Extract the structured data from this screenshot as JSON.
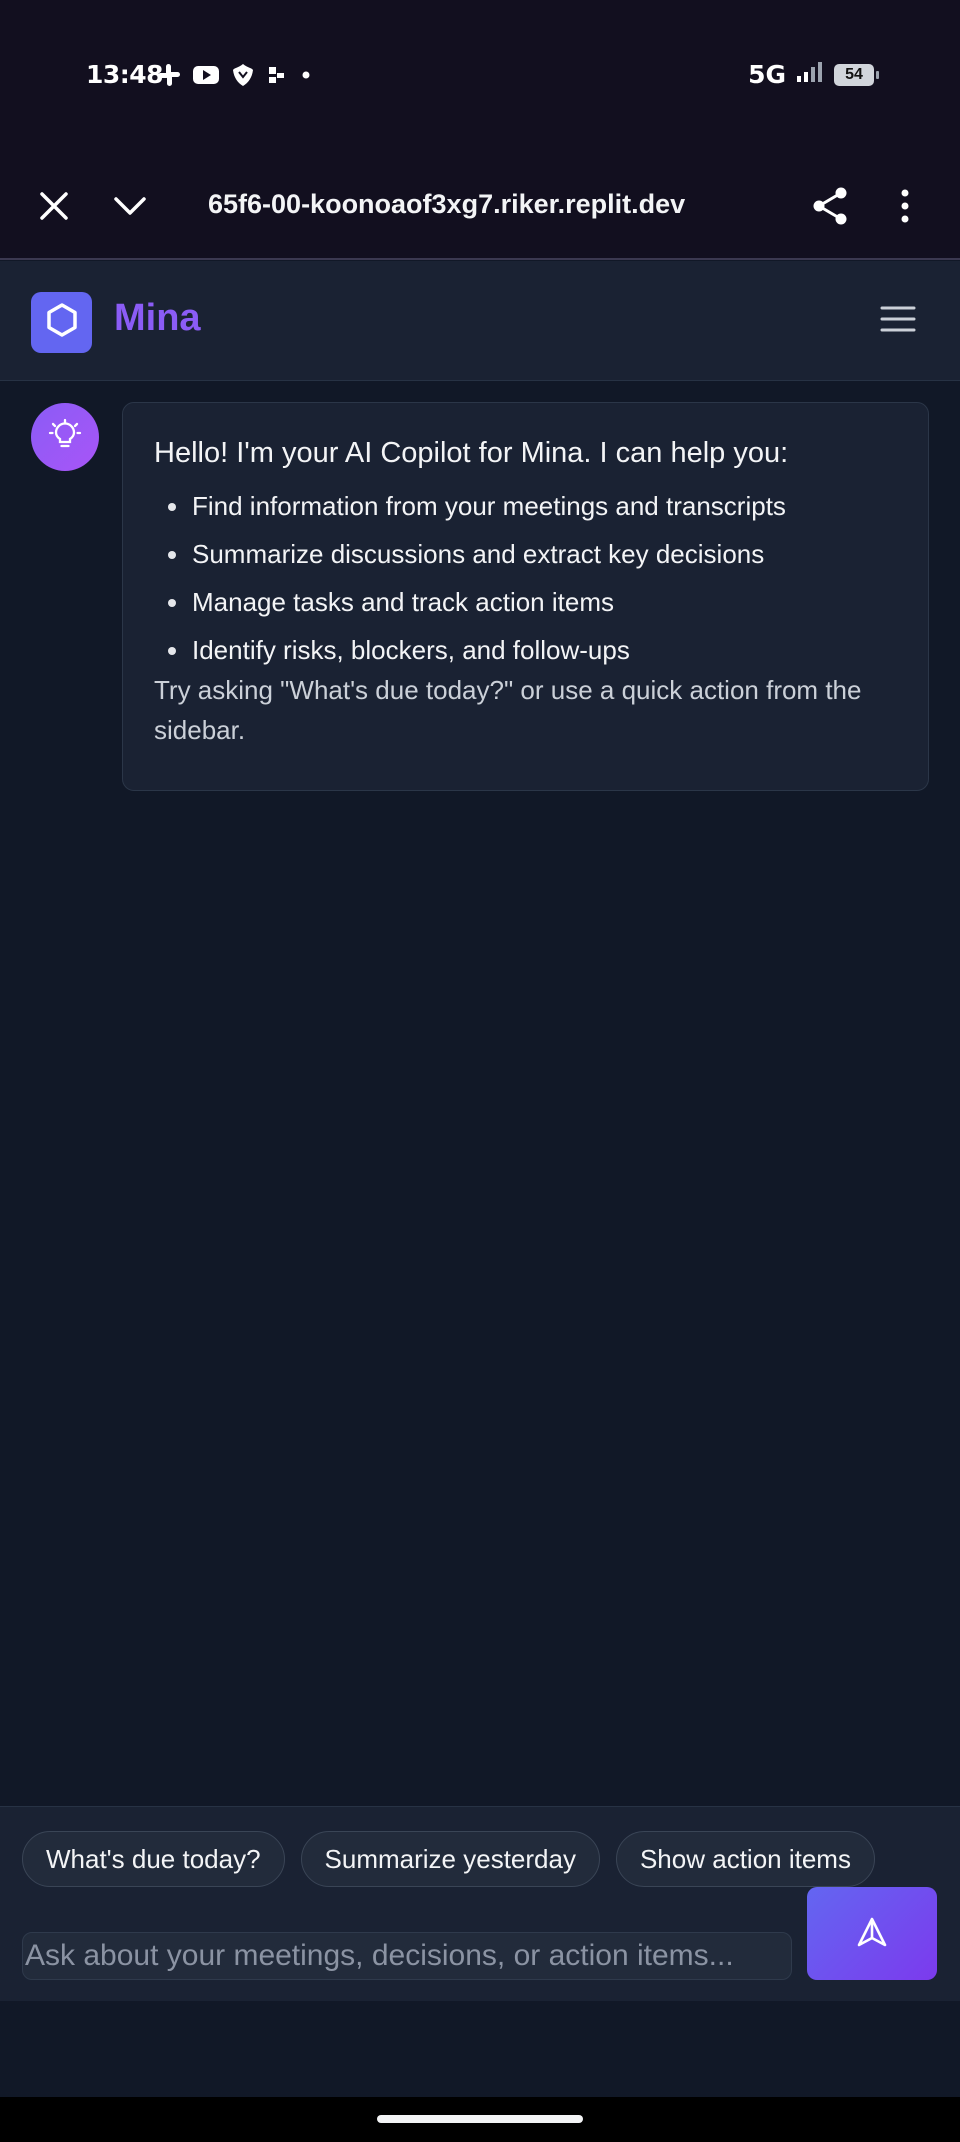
{
  "status_bar": {
    "time": "13:48",
    "notification_icons": [
      "slack-icon",
      "youtube-icon",
      "bank-icon",
      "puzzle-icon",
      "dot-icon"
    ],
    "network": "5G",
    "battery": "54"
  },
  "browser": {
    "url": "65f6-00-koonoaof3xg7.riker.replit.dev",
    "icons": [
      "close-icon",
      "chevron-down-icon",
      "share-icon",
      "more-vertical-icon"
    ]
  },
  "app": {
    "name": "Mina",
    "logo_icon": "hexagon-icon",
    "menu_icon": "hamburger-menu-icon",
    "accent_color": "#8b5cf6"
  },
  "chat": {
    "assistant_avatar_icon": "lightbulb-icon",
    "messages": [
      {
        "intro": "Hello! I'm your AI Copilot for Mina. I can help you:",
        "bullets": [
          "Find information from your meetings and transcripts",
          "Summarize discussions and extract key decisions",
          "Manage tasks and track action items",
          "Identify risks, blockers, and follow-ups"
        ],
        "outro": "Try asking \"What's due today?\" or use a quick action from the sidebar."
      }
    ]
  },
  "composer": {
    "quick_actions": [
      "What's due today?",
      "Summarize yesterday",
      "Show action items"
    ],
    "input_placeholder": "Ask about your meetings, decisions, or action items...",
    "input_value": "",
    "send_icon": "send-icon"
  }
}
